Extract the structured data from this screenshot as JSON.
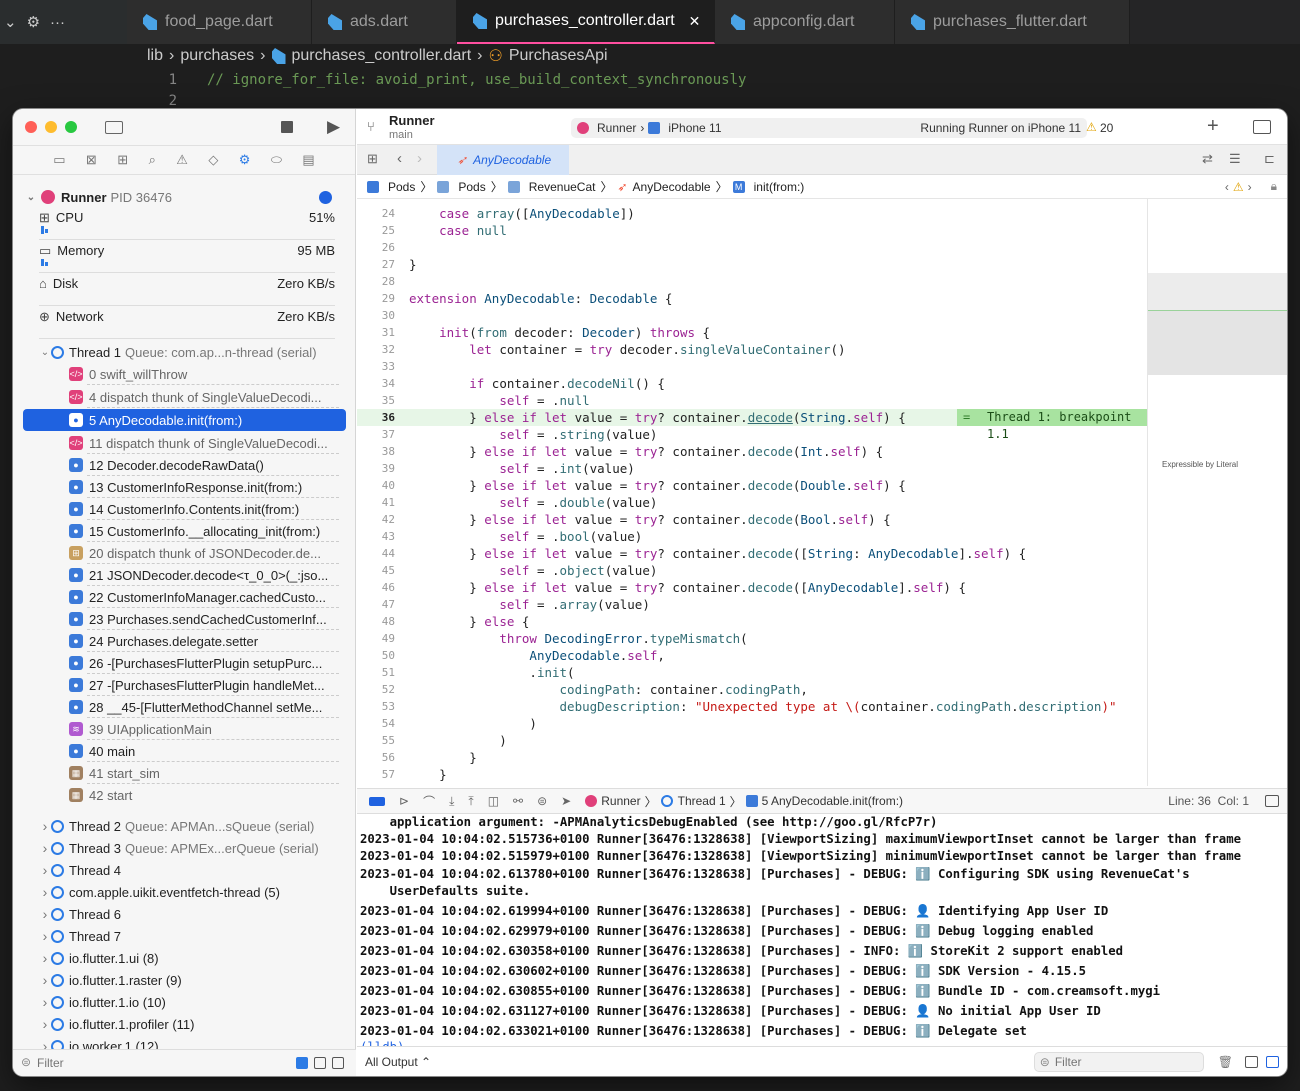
{
  "vscode": {
    "tabs": [
      {
        "label": "food_page.dart"
      },
      {
        "label": "ads.dart"
      },
      {
        "label": "purchases_controller.dart",
        "close": "✕"
      },
      {
        "label": "appconfig.dart"
      },
      {
        "label": "purchases_flutter.dart"
      }
    ],
    "breadcrumb": [
      "lib",
      "purchases",
      "purchases_controller.dart",
      "PurchasesApi"
    ],
    "lines": [
      {
        "n": "1",
        "text": "// ignore_for_file: avoid_print, use_build_context_synchronously"
      },
      {
        "n": "2",
        "text": ""
      }
    ]
  },
  "xcode": {
    "scheme_title": "Runner",
    "scheme_branch": "main",
    "run_dest_app": "Runner",
    "run_dest_device": "iPhone 11",
    "status": "Running Runner on iPhone 11",
    "warning_count": "20",
    "editor_tab": "AnyDecodable",
    "jump": [
      "Pods",
      "Pods",
      "RevenueCat",
      "AnyDecodable",
      "init(from:)"
    ],
    "minimap_note": "Expressible by Literal",
    "breakpoint_label": "Thread 1: breakpoint 1.1",
    "debug_path": [
      "Runner",
      "Thread 1",
      "5 AnyDecodable.init(from:)"
    ],
    "line_col": "Line: 36  Col: 1",
    "output_selector": "All Output ⌃",
    "filter_placeholder": "Filter"
  },
  "navigator": {
    "process": {
      "name": "Runner",
      "pid": "PID 36476"
    },
    "gauges": [
      {
        "label": "CPU",
        "value": "51%",
        "level": 0.51
      },
      {
        "label": "Memory",
        "value": "95 MB"
      },
      {
        "label": "Disk",
        "value": "Zero KB/s"
      },
      {
        "label": "Network",
        "value": "Zero KB/s"
      }
    ],
    "thread1": {
      "name": "Thread 1",
      "queue": "Queue: com.ap...n-thread (serial)"
    },
    "frames": [
      {
        "label": "0 swift_willThrow",
        "kind": "p"
      },
      {
        "label": "4 dispatch thunk of SingleValueDecodi...",
        "kind": "p"
      },
      {
        "label": "5 AnyDecodable.init(from:)",
        "kind": "b",
        "selected": true
      },
      {
        "label": "11 dispatch thunk of SingleValueDecodi...",
        "kind": "p"
      },
      {
        "label": "12 Decoder.decodeRawData()",
        "kind": "b"
      },
      {
        "label": "13 CustomerInfoResponse.init(from:)",
        "kind": "b"
      },
      {
        "label": "14 CustomerInfo.Contents.init(from:)",
        "kind": "b"
      },
      {
        "label": "15 CustomerInfo.__allocating_init(from:)",
        "kind": "b"
      },
      {
        "label": "20 dispatch thunk of JSONDecoder.de...",
        "kind": "o"
      },
      {
        "label": "21 JSONDecoder.decode<τ_0_0>(_:jso...",
        "kind": "b"
      },
      {
        "label": "22 CustomerInfoManager.cachedCusto...",
        "kind": "b"
      },
      {
        "label": "23 Purchases.sendCachedCustomerInf...",
        "kind": "b"
      },
      {
        "label": "24 Purchases.delegate.setter",
        "kind": "b"
      },
      {
        "label": "26 -[PurchasesFlutterPlugin setupPurc...",
        "kind": "b"
      },
      {
        "label": "27 -[PurchasesFlutterPlugin handleMet...",
        "kind": "b"
      },
      {
        "label": "28 __45-[FlutterMethodChannel setMe...",
        "kind": "b"
      },
      {
        "label": "39 UIApplicationMain",
        "kind": "m"
      },
      {
        "label": "40 main",
        "kind": "b"
      },
      {
        "label": "41 start_sim",
        "kind": "g"
      },
      {
        "label": "42 start",
        "kind": "g"
      }
    ],
    "threads": [
      {
        "name": "Thread 2",
        "queue": "Queue: APMAn...sQueue (serial)"
      },
      {
        "name": "Thread 3",
        "queue": "Queue: APMEx...erQueue (serial)"
      },
      {
        "name": "Thread 4",
        "queue": ""
      },
      {
        "name": "com.apple.uikit.eventfetch-thread (5)",
        "queue": ""
      },
      {
        "name": "Thread 6",
        "queue": ""
      },
      {
        "name": "Thread 7",
        "queue": ""
      },
      {
        "name": "io.flutter.1.ui (8)",
        "queue": ""
      },
      {
        "name": "io.flutter.1.raster (9)",
        "queue": ""
      },
      {
        "name": "io.flutter.1.io (10)",
        "queue": ""
      },
      {
        "name": "io.flutter.1.profiler (11)",
        "queue": ""
      },
      {
        "name": "io.worker.1 (12)",
        "queue": ""
      }
    ],
    "filter_placeholder": "Filter"
  },
  "code": [
    {
      "n": "24",
      "html": "    <span class=\"kw\">case</span> <span class=\"fn\">array</span>([<span class=\"ty\">AnyDecodable</span>])"
    },
    {
      "n": "25",
      "html": "    <span class=\"kw\">case</span> <span class=\"fn\">null</span>"
    },
    {
      "n": "26",
      "html": ""
    },
    {
      "n": "27",
      "html": "}"
    },
    {
      "n": "28",
      "html": ""
    },
    {
      "n": "29",
      "html": "<span class=\"kw\">extension</span> <span class=\"ty\">AnyDecodable</span>: <span class=\"ty\">Decodable</span> {"
    },
    {
      "n": "30",
      "html": ""
    },
    {
      "n": "31",
      "html": "    <span class=\"kw\">init</span>(<span class=\"fn\">from</span> decoder: <span class=\"ty\">Decoder</span>) <span class=\"kw\">throws</span> {"
    },
    {
      "n": "32",
      "html": "        <span class=\"kw\">let</span> container = <span class=\"kw\">try</span> decoder.<span class=\"fn\">singleValueContainer</span>()"
    },
    {
      "n": "33",
      "html": ""
    },
    {
      "n": "34",
      "html": "        <span class=\"kw\">if</span> container.<span class=\"fn\">decodeNil</span>() {"
    },
    {
      "n": "35",
      "html": "            <span class=\"kw\">self</span> = .<span class=\"fn\">null</span>"
    },
    {
      "n": "36",
      "html": "        } <span class=\"kw\">else if let</span> value = <span class=\"kw\">try</span>? container.<span class=\"fn\" style=\"text-decoration:underline\">decode</span>(<span class=\"ty\">String</span>.<span class=\"kw\">self</span>) {",
      "bp": true
    },
    {
      "n": "37",
      "html": "            <span class=\"kw\">self</span> = .<span class=\"fn\">string</span>(value)"
    },
    {
      "n": "38",
      "html": "        } <span class=\"kw\">else if let</span> value = <span class=\"kw\">try</span>? container.<span class=\"fn\">decode</span>(<span class=\"ty\">Int</span>.<span class=\"kw\">self</span>) {"
    },
    {
      "n": "39",
      "html": "            <span class=\"kw\">self</span> = .<span class=\"fn\">int</span>(value)"
    },
    {
      "n": "40",
      "html": "        } <span class=\"kw\">else if let</span> value = <span class=\"kw\">try</span>? container.<span class=\"fn\">decode</span>(<span class=\"ty\">Double</span>.<span class=\"kw\">self</span>) {"
    },
    {
      "n": "41",
      "html": "            <span class=\"kw\">self</span> = .<span class=\"fn\">double</span>(value)"
    },
    {
      "n": "42",
      "html": "        } <span class=\"kw\">else if let</span> value = <span class=\"kw\">try</span>? container.<span class=\"fn\">decode</span>(<span class=\"ty\">Bool</span>.<span class=\"kw\">self</span>) {"
    },
    {
      "n": "43",
      "html": "            <span class=\"kw\">self</span> = .<span class=\"fn\">bool</span>(value)"
    },
    {
      "n": "44",
      "html": "        } <span class=\"kw\">else if let</span> value = <span class=\"kw\">try</span>? container.<span class=\"fn\">decode</span>([<span class=\"ty\">String</span>: <span class=\"ty\">AnyDecodable</span>].<span class=\"kw\">self</span>) {"
    },
    {
      "n": "45",
      "html": "            <span class=\"kw\">self</span> = .<span class=\"fn\">object</span>(value)"
    },
    {
      "n": "46",
      "html": "        } <span class=\"kw\">else if let</span> value = <span class=\"kw\">try</span>? container.<span class=\"fn\">decode</span>([<span class=\"ty\">AnyDecodable</span>].<span class=\"kw\">self</span>) {"
    },
    {
      "n": "47",
      "html": "            <span class=\"kw\">self</span> = .<span class=\"fn\">array</span>(value)"
    },
    {
      "n": "48",
      "html": "        } <span class=\"kw\">else</span> {"
    },
    {
      "n": "49",
      "html": "            <span class=\"kw\">throw</span> <span class=\"ty\">DecodingError</span>.<span class=\"fn\">typeMismatch</span>("
    },
    {
      "n": "50",
      "html": "                <span class=\"ty\">AnyDecodable</span>.<span class=\"kw\">self</span>,"
    },
    {
      "n": "51",
      "html": "                .<span class=\"fn\">init</span>("
    },
    {
      "n": "52",
      "html": "                    <span class=\"fn\">codingPath</span>: container.<span class=\"fn\">codingPath</span>,"
    },
    {
      "n": "53",
      "html": "                    <span class=\"fn\">debugDescription</span>: <span class=\"st\">\"Unexpected type at \\(</span>container.<span class=\"fn\">codingPath</span>.<span class=\"fn\">description</span><span class=\"st\">)\"</span>"
    },
    {
      "n": "54",
      "html": "                )"
    },
    {
      "n": "55",
      "html": "            )"
    },
    {
      "n": "56",
      "html": "        }"
    },
    {
      "n": "57",
      "html": "    }"
    }
  ],
  "console": [
    "    application argument: -APMAnalyticsDebugEnabled (see http://goo.gl/RfcP7r)",
    "2023-01-04 10:04:02.515736+0100 Runner[36476:1328638] [ViewportSizing] maximumViewportInset cannot be larger than frame",
    "2023-01-04 10:04:02.515979+0100 Runner[36476:1328638] [ViewportSizing] minimumViewportInset cannot be larger than frame",
    "2023-01-04 10:04:02.613780+0100 Runner[36476:1328638] [Purchases] - DEBUG: ℹ️ Configuring SDK using RevenueCat's",
    "    UserDefaults suite.",
    "2023-01-04 10:04:02.619994+0100 Runner[36476:1328638] [Purchases] - DEBUG: 👤 Identifying App User ID",
    "2023-01-04 10:04:02.629979+0100 Runner[36476:1328638] [Purchases] - DEBUG: ℹ️ Debug logging enabled",
    "2023-01-04 10:04:02.630358+0100 Runner[36476:1328638] [Purchases] - INFO: ℹ️ StoreKit 2 support enabled",
    "2023-01-04 10:04:02.630602+0100 Runner[36476:1328638] [Purchases] - DEBUG: ℹ️ SDK Version - 4.15.5",
    "2023-01-04 10:04:02.630855+0100 Runner[36476:1328638] [Purchases] - DEBUG: ℹ️ Bundle ID - com.creamsoft.mygi",
    "2023-01-04 10:04:02.631127+0100 Runner[36476:1328638] [Purchases] - DEBUG: 👤 No initial App User ID",
    "2023-01-04 10:04:02.633021+0100 Runner[36476:1328638] [Purchases] - DEBUG: ℹ️ Delegate set"
  ],
  "prompt": "(lldb)"
}
